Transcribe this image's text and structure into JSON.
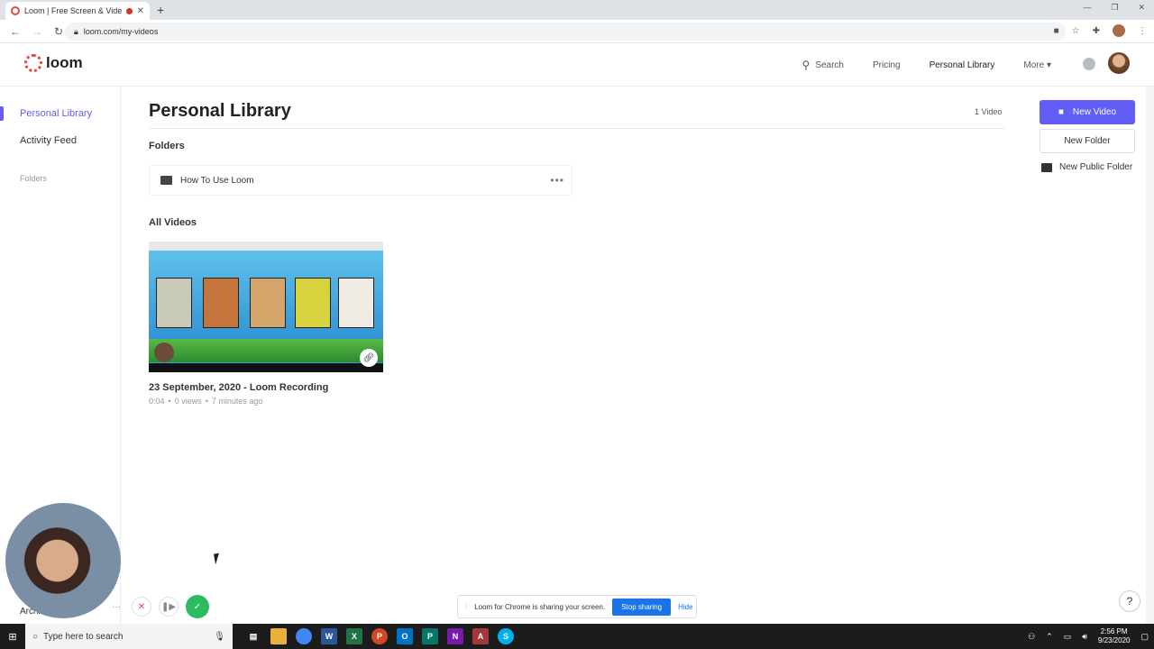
{
  "browser": {
    "tab_title": "Loom | Free Screen & Video",
    "url": "loom.com/my-videos"
  },
  "topbar": {
    "logo_text": "loom",
    "nav": [
      "Search",
      "Pricing",
      "Personal Library",
      "More"
    ]
  },
  "sidebar": {
    "items": [
      {
        "label": "Personal Library",
        "active": true
      },
      {
        "label": "Activity Feed",
        "active": false
      }
    ],
    "folders_label": "Folders",
    "archive_label": "Archi"
  },
  "main": {
    "title": "Personal Library",
    "video_count": "1 Video",
    "folders_heading": "Folders",
    "folders": [
      {
        "name": "How To Use Loom"
      }
    ],
    "all_videos_heading": "All Videos",
    "videos": [
      {
        "title": "23 September, 2020 - Loom Recording",
        "duration": "0:04",
        "views": "0 views",
        "age": "7 minutes ago"
      }
    ]
  },
  "actions": {
    "new_video": "New Video",
    "new_folder": "New Folder",
    "new_public_folder": "New Public Folder"
  },
  "share_bar": {
    "message": "Loom for Chrome is sharing your screen.",
    "stop": "Stop sharing",
    "hide": "Hide"
  },
  "taskbar": {
    "search_placeholder": "Type here to search",
    "time": "2:56 PM",
    "date": "9/23/2020"
  },
  "colors": {
    "accent": "#625df5",
    "brand": "#e5483f",
    "share_blue": "#1a73e8",
    "record_done": "#2cbb5d"
  }
}
